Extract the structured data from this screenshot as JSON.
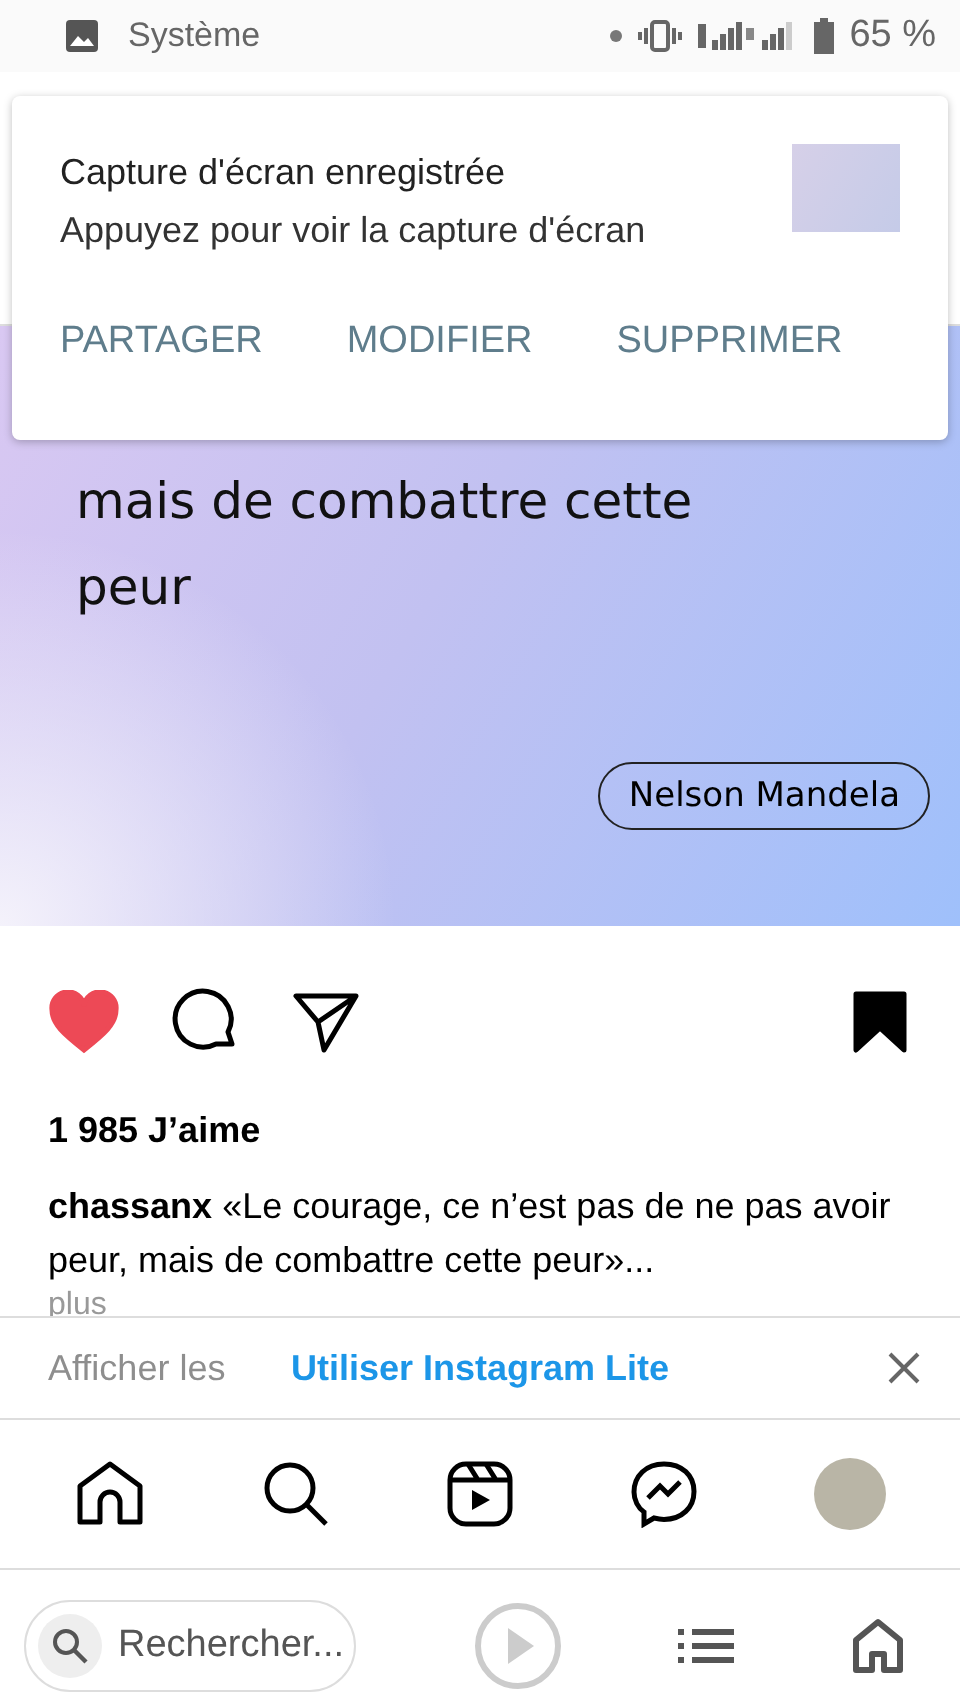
{
  "status_bar": {
    "app": "Système",
    "battery": "65 %"
  },
  "notification": {
    "title": "Capture d'écran enregistrée",
    "text": "Appuyez pour voir la capture d'écran",
    "actions": [
      "PARTAGER",
      "MODIFIER",
      "SUPPRIMER"
    ]
  },
  "post": {
    "quote_lines": [
      "mais de combattre cette",
      "peur"
    ],
    "author": "Nelson Mandela",
    "liked": true,
    "saved": true,
    "likes": "1 985 J’aime",
    "username": "chassanx",
    "caption": "«Le courage, ce n’est pas de ne pas avoir peur, mais de combattre cette peur»...",
    "more": "plus",
    "comments": "Afficher les"
  },
  "banner": {
    "text": "Utiliser Instagram Lite"
  },
  "browser_bar": {
    "search_placeholder": "Rechercher..."
  }
}
